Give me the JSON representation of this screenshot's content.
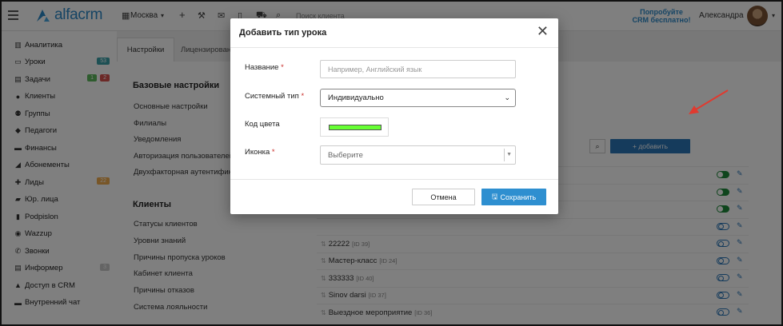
{
  "topbar": {
    "logo_text": "alfacrm",
    "branch": "Москва",
    "search_placeholder": "Поиск клиента",
    "promo": "Попробуйте CRM бесплатно!",
    "username": "Александра"
  },
  "sidebar": {
    "items": [
      {
        "label": "Аналитика",
        "icon": "analytics-icon"
      },
      {
        "label": "Уроки",
        "icon": "calendar-icon",
        "badges": [
          {
            "text": "53",
            "color": "#3aa0a8"
          }
        ]
      },
      {
        "label": "Задачи",
        "icon": "tasks-icon",
        "badges": [
          {
            "text": "1",
            "color": "#5cb85c"
          },
          {
            "text": "2",
            "color": "#d9534f"
          }
        ]
      },
      {
        "label": "Клиенты",
        "icon": "user-icon"
      },
      {
        "label": "Группы",
        "icon": "group-icon"
      },
      {
        "label": "Педагоги",
        "icon": "graduation-icon"
      },
      {
        "label": "Финансы",
        "icon": "money-icon"
      },
      {
        "label": "Абонементы",
        "icon": "tag-icon"
      },
      {
        "label": "Лиды",
        "icon": "user-plus-icon",
        "badges": [
          {
            "text": "22",
            "color": "#f0ad4e"
          }
        ]
      },
      {
        "label": "Юр. лица",
        "icon": "briefcase-icon"
      },
      {
        "label": "Podpislon",
        "icon": "file-icon"
      },
      {
        "label": "Wazzup",
        "icon": "whatsapp-icon"
      },
      {
        "label": "Звонки",
        "icon": "phone-icon"
      },
      {
        "label": "Информер",
        "icon": "list-icon",
        "badges": [
          {
            "text": "3",
            "color": "#c8c8c8"
          }
        ]
      },
      {
        "label": "Доступ в CRM",
        "icon": "lock-icon"
      },
      {
        "label": "Внутренний чат",
        "icon": "chat-icon"
      }
    ]
  },
  "content": {
    "tabs": [
      "Настройки",
      "Лицензирован"
    ],
    "sections": [
      {
        "title": "Базовые настройки",
        "links": [
          "Основные настройки",
          "Филиалы",
          "Уведомления",
          "Авторизация пользователей",
          "Двухфакторная аутентифика"
        ]
      },
      {
        "title": "Клиенты",
        "links": [
          "Статусы клиентов",
          "Уровни знаний",
          "Причины пропуска уроков",
          "Кабинет клиента",
          "Причины отказов",
          "Система лояльности"
        ]
      }
    ],
    "add_button": "+ добавить",
    "rows": [
      {
        "name": "",
        "id": "",
        "active": true
      },
      {
        "name": "",
        "id": "",
        "active": true
      },
      {
        "name": "",
        "id": "",
        "active": true
      },
      {
        "name": "",
        "id": "",
        "active": false
      },
      {
        "name": "22222",
        "id": "[ID 39]",
        "active": false
      },
      {
        "name": "Мастер-класс",
        "id": "[ID 24]",
        "active": false
      },
      {
        "name": "333333",
        "id": "[ID 40]",
        "active": false
      },
      {
        "name": "Sinov darsi",
        "id": "[ID 37]",
        "active": false
      },
      {
        "name": "Выездное мероприятие",
        "id": "[ID 36]",
        "active": false
      }
    ]
  },
  "modal": {
    "title": "Добавить тип урока",
    "name_label": "Название",
    "name_placeholder": "Например, Английский язык",
    "system_type_label": "Системный тип",
    "system_type_value": "Индивидуально",
    "color_label": "Код цвета",
    "color_value": "#66ff33",
    "icon_label": "Иконка",
    "icon_placeholder": "Выберите",
    "cancel": "Отмена",
    "save": "Сохранить"
  },
  "colors": {
    "accent": "#2a88c8",
    "primary_button": "#2e8fd0",
    "annotation_arrow": "#e03a2f"
  }
}
